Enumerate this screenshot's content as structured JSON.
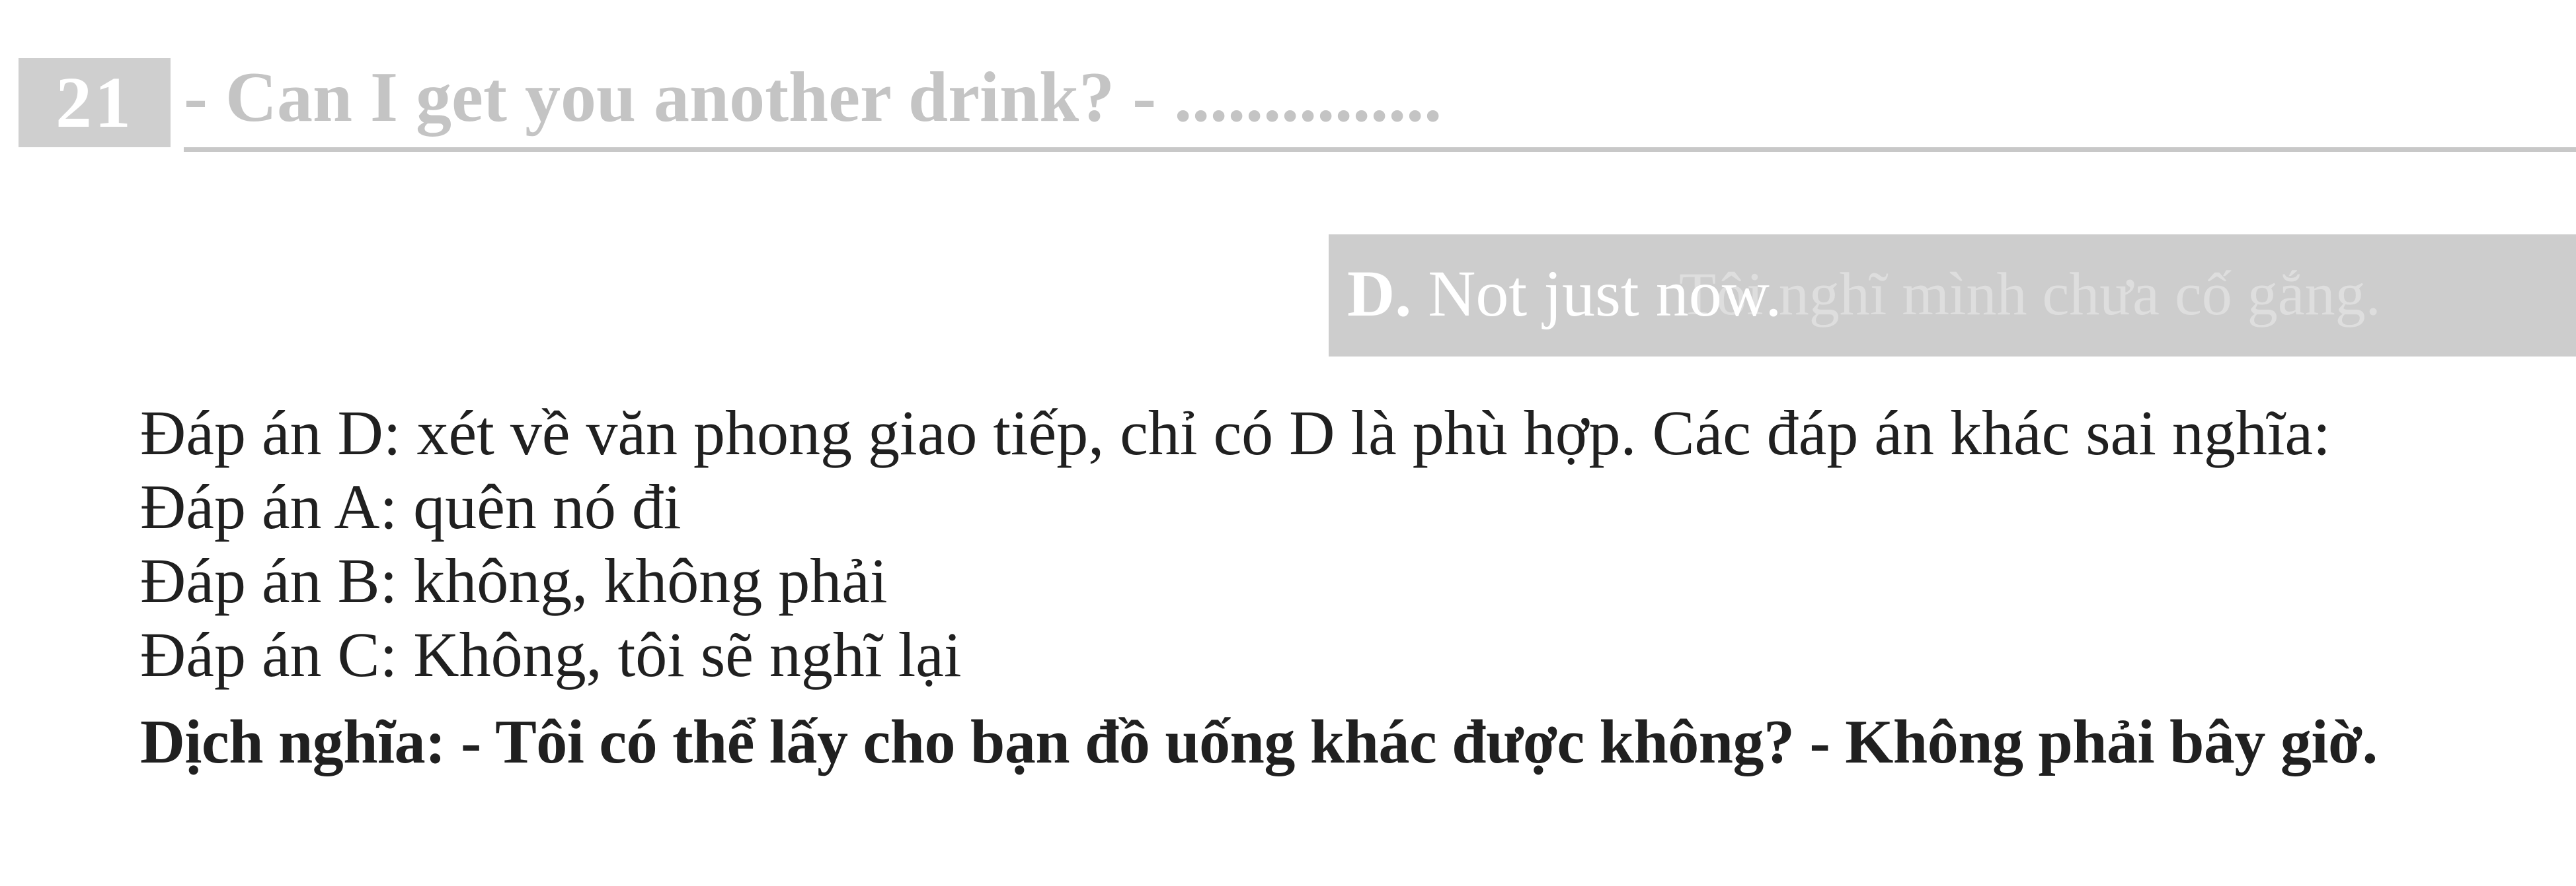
{
  "question": {
    "number": "21",
    "text": "- Can I get you another drink? - ..............."
  },
  "answer": {
    "letter": "D.",
    "text": "Not just now.",
    "faint_text": "Tôi nghĩ mình chưa cố gắng."
  },
  "explanation": {
    "lines": [
      "Đáp án D: xét về văn phong giao tiếp, chỉ có D là phù hợp. Các đáp án khác sai nghĩa:",
      "Đáp án A: quên nó đi",
      "Đáp án B: không, không phải",
      "Đáp án C: Không, tôi sẽ nghĩ lại"
    ],
    "translation": "Dịch nghĩa: - Tôi có thể lấy cho bạn đồ uống khác được không? - Không phải bây giờ."
  },
  "colors": {
    "number_bg": "#cfcfcf",
    "question_text": "#c4c4c4",
    "answer_bg": "#cdcdcd",
    "body_text": "#202020"
  }
}
